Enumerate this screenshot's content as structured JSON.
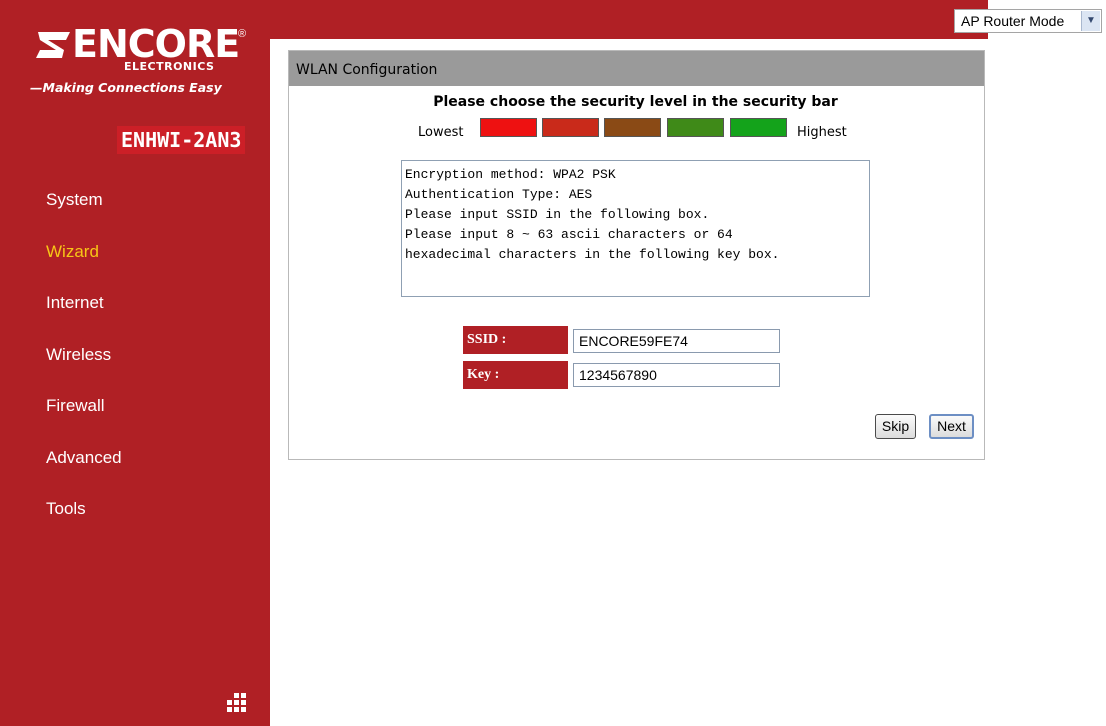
{
  "brand": {
    "logo_word": "ENCORE",
    "logo_sub": "ELECTRONICS",
    "tagline": "—Making Connections Easy",
    "model": "ENHWI-2AN3"
  },
  "nav": {
    "items": [
      {
        "label": "System"
      },
      {
        "label": "Wizard",
        "active": true
      },
      {
        "label": "Internet"
      },
      {
        "label": "Wireless"
      },
      {
        "label": "Firewall"
      },
      {
        "label": "Advanced"
      },
      {
        "label": "Tools"
      }
    ]
  },
  "mode_select": {
    "value": "AP Router Mode"
  },
  "panel": {
    "title": "WLAN Configuration",
    "security_title": "Please choose the security level in the security bar",
    "lowest_label": "Lowest",
    "highest_label": "Highest",
    "security_levels": [
      {
        "color": "#ee1111"
      },
      {
        "color": "#c92a1a"
      },
      {
        "color": "#8a4a15"
      },
      {
        "color": "#3f8a18"
      },
      {
        "color": "#14a31b"
      }
    ],
    "info_text": "Encryption method: WPA2 PSK\nAuthentication Type: AES\nPlease input SSID in the following box.\nPlease input 8 ~ 63 ascii characters or 64\nhexadecimal characters in the following key box.",
    "ssid_label": "SSID :",
    "ssid_value": "ENCORE59FE74",
    "key_label": "Key :",
    "key_value": "1234567890",
    "skip_label": "Skip",
    "next_label": "Next"
  },
  "colors": {
    "sidebar": "#b02025",
    "active_nav": "#f7c617",
    "panel_header": "#9a9a9a"
  }
}
